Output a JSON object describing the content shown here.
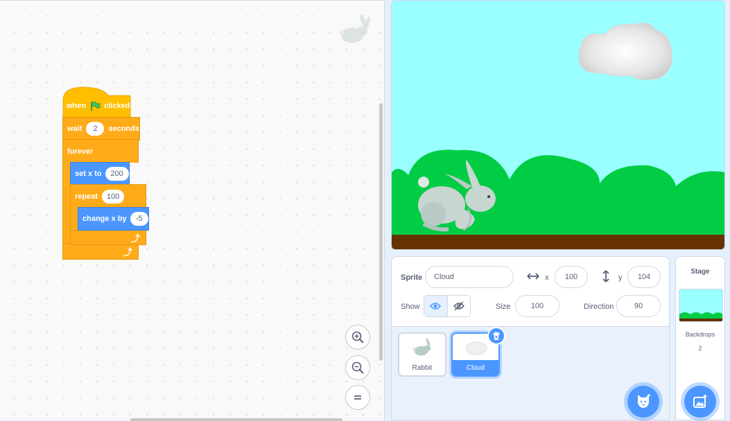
{
  "code": {
    "blocks": {
      "when": "when",
      "clicked": "clicked",
      "wait": "wait",
      "wait_value": "2",
      "seconds": "seconds",
      "forever": "forever",
      "set_x": "set x to",
      "set_x_value": "200",
      "repeat": "repeat",
      "repeat_value": "100",
      "change_x": "change x by",
      "change_x_value": "-5"
    },
    "zoom": {
      "zoom_in_icon": "zoom-in-icon",
      "zoom_out_icon": "zoom-out-icon",
      "reset_icon": "zoom-reset-icon"
    }
  },
  "sprite_info": {
    "sprite_label": "Sprite",
    "sprite_name": "Cloud",
    "x_label": "x",
    "x_value": "100",
    "y_label": "y",
    "y_value": "104",
    "show_label": "Show",
    "size_label": "Size",
    "size_value": "100",
    "direction_label": "Direction",
    "direction_value": "90"
  },
  "sprites": [
    {
      "name": "Rabbit",
      "selected": false
    },
    {
      "name": "Cloud",
      "selected": true
    }
  ],
  "stage_pane": {
    "title": "Stage",
    "backdrops_label": "Backdrops",
    "backdrops_count": "2"
  },
  "colors": {
    "sky": "#99ffff",
    "hills": "#00cc44",
    "ground": "#663300",
    "accent": "#4c97ff",
    "events": "#ffbf00",
    "control": "#ffab19",
    "motion": "#4c97ff"
  }
}
